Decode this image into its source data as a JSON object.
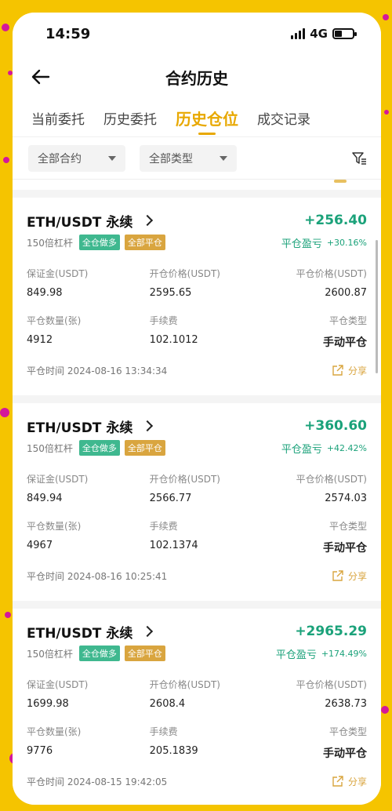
{
  "status": {
    "time": "14:59",
    "network": "4G"
  },
  "nav": {
    "title": "合约历史"
  },
  "tabs": [
    {
      "label": "当前委托",
      "active": false
    },
    {
      "label": "历史委托",
      "active": false
    },
    {
      "label": "历史仓位",
      "active": true
    },
    {
      "label": "成交记录",
      "active": false
    }
  ],
  "filters": {
    "contract": "全部合约",
    "type": "全部类型"
  },
  "labels": {
    "margin": "保证金(USDT)",
    "open_price": "开仓价格(USDT)",
    "close_price": "平仓价格(USDT)",
    "close_qty": "平仓数量(张)",
    "fee": "手续费",
    "close_type": "平仓类型",
    "pnl_label": "平仓盈亏",
    "share": "分享",
    "close_time_prefix": "平仓时间"
  },
  "positions": [
    {
      "pair": "ETH/USDT 永续",
      "pnl": "+256.40",
      "leverage": "150倍杠杆",
      "badge_side": "全仓做多",
      "badge_close": "全部平仓",
      "pnl_pct": "+30.16%",
      "margin": "849.98",
      "open_price": "2595.65",
      "close_price": "2600.87",
      "close_qty": "4912",
      "fee": "102.1012",
      "close_type": "手动平仓",
      "close_time": "2024-08-16 13:34:34"
    },
    {
      "pair": "ETH/USDT 永续",
      "pnl": "+360.60",
      "leverage": "150倍杠杆",
      "badge_side": "全仓做多",
      "badge_close": "全部平仓",
      "pnl_pct": "+42.42%",
      "margin": "849.94",
      "open_price": "2566.77",
      "close_price": "2574.03",
      "close_qty": "4967",
      "fee": "102.1374",
      "close_type": "手动平仓",
      "close_time": "2024-08-16 10:25:41"
    },
    {
      "pair": "ETH/USDT 永续",
      "pnl": "+2965.29",
      "leverage": "150倍杠杆",
      "badge_side": "全仓做多",
      "badge_close": "全部平仓",
      "pnl_pct": "+174.49%",
      "margin": "1699.98",
      "open_price": "2608.4",
      "close_price": "2638.73",
      "close_qty": "9776",
      "fee": "205.1839",
      "close_type": "手动平仓",
      "close_time": "2024-08-15 19:42:05"
    }
  ],
  "colors": {
    "accent": "#e8a800",
    "profit": "#1ba27a",
    "background": "#f5c400"
  }
}
